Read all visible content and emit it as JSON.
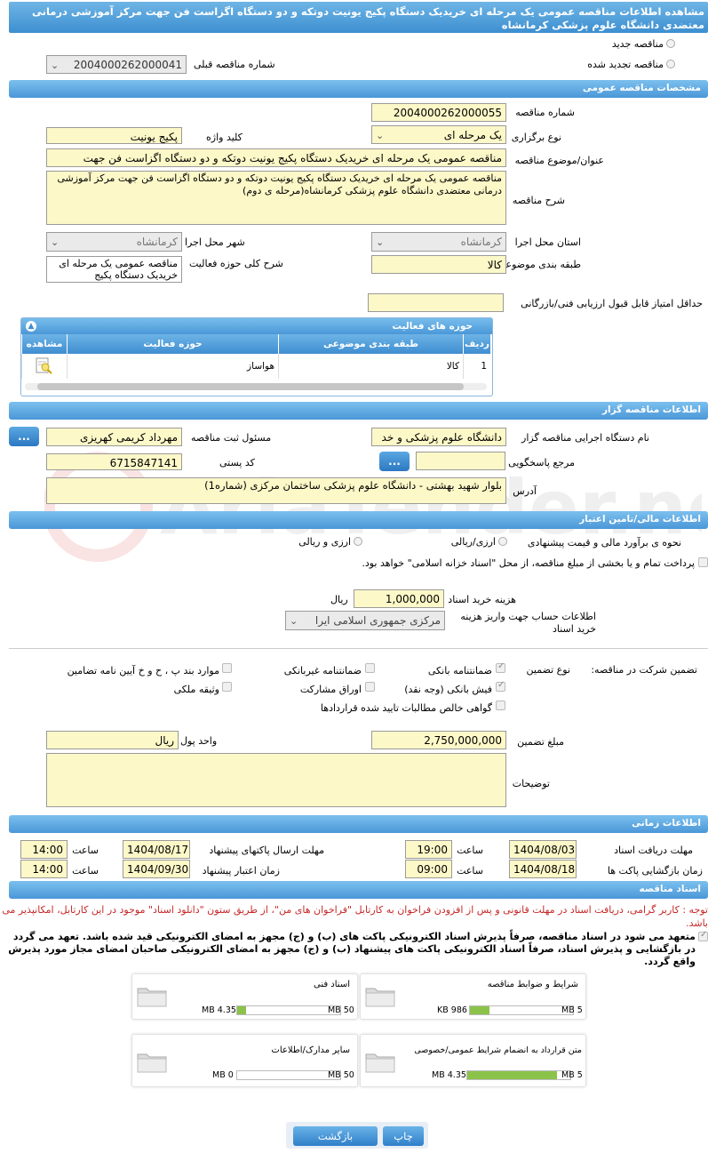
{
  "title": "مشاهده اطلاعات مناقصه عمومی یک مرحله ای خریدیک دستگاه پکیج یونیت دوتکه و دو دستگاه اگزاست فن جهت مرکز آموزشی درمانی معتضدی دانشگاه علوم پزشکی کرمانشاه",
  "top": {
    "new_label": "مناقصه جدید",
    "renewed_label": "مناقصه تجدید شده",
    "prev_number_label": "شماره مناقصه قبلی",
    "prev_number": "2004000262000041"
  },
  "general": {
    "header": "مشخصات مناقصه عمومی",
    "number_label": "شماره مناقصه",
    "number": "2004000262000055",
    "type_label": "نوع برگزاری",
    "type": "یک مرحله ای",
    "keyword_label": "کلید واژه",
    "keyword": "پکیج یونیت",
    "subject_label": "عنوان/موضوع مناقصه",
    "subject": "مناقصه عمومی یک مرحله ای خریدیک دستگاه پکیج یونیت دوتکه و دو دستگاه اگزاست فن جهت",
    "desc_label": "شرح مناقصه",
    "desc": "مناقصه عمومی یک مرحله ای خریدیک دستگاه پکیج یونیت دوتکه و دو دستگاه اگزاست فن جهت مرکز آموزشی درمانی معتضدی دانشگاه علوم پزشکی کرمانشاه(مرحله ی دوم)",
    "province_label": "استان محل اجرا",
    "province": "کرمانشاه",
    "city_label": "شهر محل اجرا",
    "city": "کرمانشاه",
    "category_label": "طبقه بندی موضوعی",
    "category": "کالا",
    "activity_desc_label": "شرح کلی حوزه فعالیت",
    "activity_desc": "مناقصه عمومی یک مرحله ای خریدیک دستگاه پکیج",
    "min_score_label": "حداقل امتیاز قابل قبول ارزیابی فنی/بازرگانی",
    "min_score": ""
  },
  "activity": {
    "header": "حوزه های فعالیت",
    "columns": [
      "ردیف",
      "طبقه بندی موضوعی",
      "حوزه فعالیت",
      "مشاهده"
    ],
    "rows": [
      [
        "1",
        "کالا",
        "هواساز",
        ""
      ]
    ]
  },
  "organizer": {
    "header": "اطلاعات مناقصه گزار",
    "org_label": "نام دستگاه اجرایی مناقصه گزار",
    "org": "دانشگاه علوم پزشکی و خد",
    "registrar_label": "مسئول ثبت مناقصه",
    "registrar": "مهرداد کریمی کهریزی",
    "ref_label": "مرجع پاسخگویی",
    "ref": "",
    "postal_label": "کد پستی",
    "postal": "6715847141",
    "address_label": "آدرس",
    "address": "بلوار شهید بهشتی - دانشگاه علوم پزشکی ساختمان مرکزی (شماره1)",
    "dots": "..."
  },
  "finance": {
    "header": "اطلاعات مالی/تامین اعتبار",
    "estimate_label": "نحوه ی برآورد مالی و قیمت پیشنهادی",
    "opt1": "ارزی/ریالی",
    "opt2": "ارزی و ریالی",
    "treasury_text": "پرداخت تمام و یا بخشی از مبلغ مناقصه، از محل \"اسناد خزانه اسلامی\" خواهد بود.",
    "doc_fee_label": "هزینه خرید اسناد",
    "doc_fee": "1,000,000",
    "rial": "ریال",
    "account_label": "اطلاعات حساب جهت واریز هزینه خرید اسناد",
    "account": "مرکزی جمهوری اسلامی ایرا"
  },
  "guarantee": {
    "title": "تضمین شرکت در مناقصه:",
    "type_label": "نوع تضمین",
    "items": [
      "ضمانتنامه بانکی",
      "ضمانتنامه غیربانکی",
      "موارد بند پ ، ح و خ آیین نامه تضامین",
      "فیش بانکی (وجه نقد)",
      "اوراق مشارکت",
      "وثیقه ملکی",
      "گواهی خالص مطالبات تایید شده قراردادها"
    ],
    "amount_label": "مبلغ تضمین",
    "amount": "2,750,000,000",
    "unit_label": "واحد پول",
    "unit": "ریال",
    "notes_label": "توضیحات",
    "notes": ""
  },
  "timing": {
    "header": "اطلاعات زمانی",
    "receive_deadline_label": "مهلت دریافت اسناد",
    "receive_deadline_date": "1404/08/03",
    "send_deadline_label": "مهلت ارسال پاکتهای پیشنهاد",
    "send_deadline_date": "1404/08/17",
    "opening_label": "زمان بازگشایی پاکت ها",
    "opening_date": "1404/08/18",
    "validity_label": "زمان اعتبار پیشنهاد",
    "validity_date": "1404/09/30",
    "time_label": "ساعت",
    "t1": "19:00",
    "t2": "14:00",
    "t3": "09:00",
    "t4": "14:00"
  },
  "documents": {
    "header": "اسناد مناقصه",
    "notice": "توجه : کاربر گرامی، دریافت اسناد در مهلت قانونی و پس از افزودن فراخوان به کارتابل \"فراخوان های من\"، از طریق ستون \"دانلود اسناد\" موجود در این کارتابل، امکانپذیر می باشد.",
    "commitment": "متعهد می شود در اسناد مناقصه، صرفاً پذیرش اسناد الکترونیکی پاکت های (ب) و (ج) مجهز به امضای الکترونیکی قید شده باشد. تعهد می گردد در بازگشایی و پذیرش اسناد، صرفاً اسناد الکترونیکی پاکت های پیشنهاد (ب) و (ج) مجهز به امضای الکترونیکی صاحبان امضای مجاز مورد پذیرش واقع گردد.",
    "cards": [
      {
        "name": "شرایط و ضوابط مناقصه",
        "used": "986 KB",
        "max": "5 MB",
        "fill": 0.19
      },
      {
        "name": "اسناد فنی",
        "used": "4.35 MB",
        "max": "50 MB",
        "fill": 0.09
      },
      {
        "name": "متن قرارداد به انضمام شرایط عمومی/خصوصی",
        "used": "4.35 MB",
        "max": "5 MB",
        "fill": 0.87
      },
      {
        "name": "سایر مدارک/اطلاعات",
        "used": "0 MB",
        "max": "50 MB",
        "fill": 0
      }
    ]
  },
  "buttons": {
    "back": "بازگشت",
    "print": "چاپ"
  },
  "watermark": "AriaTender.neT",
  "colors": {
    "header_blue": "#4a97d8",
    "field_yellow": "#fdf8c8",
    "accent_red": "#c62828"
  }
}
